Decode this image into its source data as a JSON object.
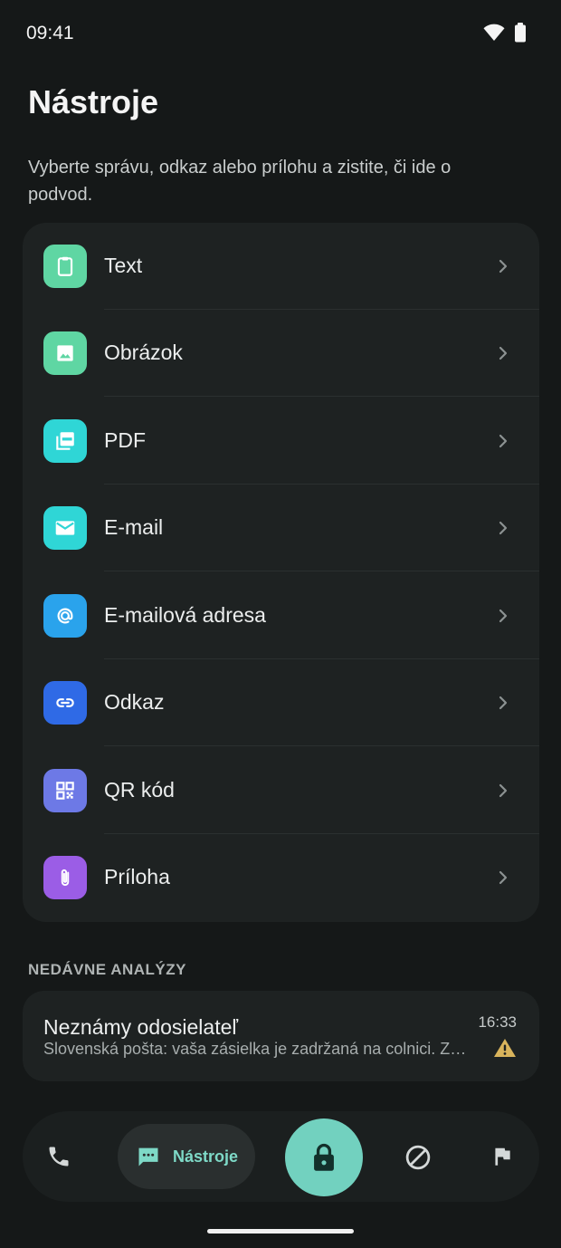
{
  "status_bar": {
    "time": "09:41",
    "icons": [
      "wifi-icon",
      "battery-icon"
    ]
  },
  "header": {
    "title": "Nástroje",
    "description": "Vyberte správu, odkaz alebo prílohu a zistite, či ide o podvod."
  },
  "tools": [
    {
      "label": "Text",
      "icon": "clipboard-icon",
      "color": "#5fd6a3"
    },
    {
      "label": "Obrázok",
      "icon": "image-icon",
      "color": "#5fd6a3"
    },
    {
      "label": "PDF",
      "icon": "pdf-icon",
      "color": "#2fd6d6"
    },
    {
      "label": "E-mail",
      "icon": "mail-icon",
      "color": "#2fd6d6"
    },
    {
      "label": "E-mailová adresa",
      "icon": "at-sign-icon",
      "color": "#2aa3ec"
    },
    {
      "label": "Odkaz",
      "icon": "link-icon",
      "color": "#2f6ae6"
    },
    {
      "label": "QR kód",
      "icon": "qr-code-icon",
      "color": "#6d79e6"
    },
    {
      "label": "Príloha",
      "icon": "paperclip-icon",
      "color": "#9b5de6"
    }
  ],
  "recent": {
    "section_title": "NEDÁVNE ANALÝZY",
    "items": [
      {
        "sender": "Neznámy odosielateľ",
        "preview": "Slovenská pošta: vaša zásielka je zadržaná na colnici. Zaplaťte poplatok",
        "time": "16:33",
        "status_icon": "warning-icon",
        "status_color": "#d9b45c"
      }
    ]
  },
  "bottom_nav": {
    "items": [
      {
        "name": "calls",
        "icon": "phone-icon"
      },
      {
        "name": "tools",
        "label": "Nástroje",
        "icon": "chat-bubble-icon",
        "active": true
      },
      {
        "name": "protection",
        "icon": "lock-icon"
      },
      {
        "name": "blocked",
        "icon": "block-icon"
      },
      {
        "name": "reports",
        "icon": "flag-icon"
      }
    ],
    "accent_color": "#72d1bf"
  }
}
